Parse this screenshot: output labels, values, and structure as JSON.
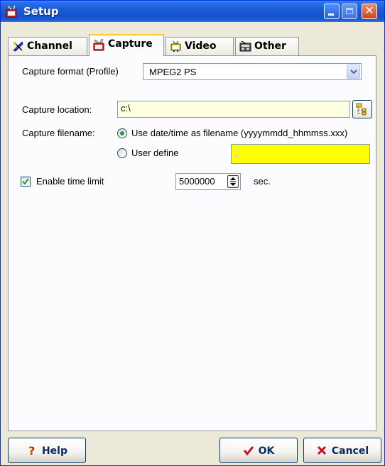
{
  "window": {
    "title": "Setup"
  },
  "tabs": [
    {
      "label": "Channel",
      "icon": "satellite-icon",
      "active": false
    },
    {
      "label": "Capture",
      "icon": "capture-icon",
      "active": true
    },
    {
      "label": "Video",
      "icon": "tv-icon",
      "active": false
    },
    {
      "label": "Other",
      "icon": "radio-icon",
      "active": false
    }
  ],
  "capture": {
    "format_label": "Capture format (Profile)",
    "format_value": "MPEG2 PS",
    "location_label": "Capture location:",
    "location_value": "c:\\",
    "filename_label": "Capture filename:",
    "option_datetime": "Use date/time as filename (yyyymmdd_hhmmss.xxx)",
    "option_user": "User define",
    "user_define_value": "2",
    "selected_option": "datetime",
    "time_limit_label": "Enable time limit",
    "time_limit_checked": true,
    "time_limit_value": "5000000",
    "time_limit_unit": "sec."
  },
  "buttons": {
    "help": "Help",
    "ok": "OK",
    "cancel": "Cancel"
  },
  "colors": {
    "titlebar": "#1c5cd6",
    "tab_highlight": "#ffc83c",
    "textbox_bg": "#ffffe1",
    "user_define_bg": "#ffff00",
    "radio_dot": "#21a121",
    "cancel_icon": "#c8102e",
    "ok_icon": "#c8102e"
  }
}
